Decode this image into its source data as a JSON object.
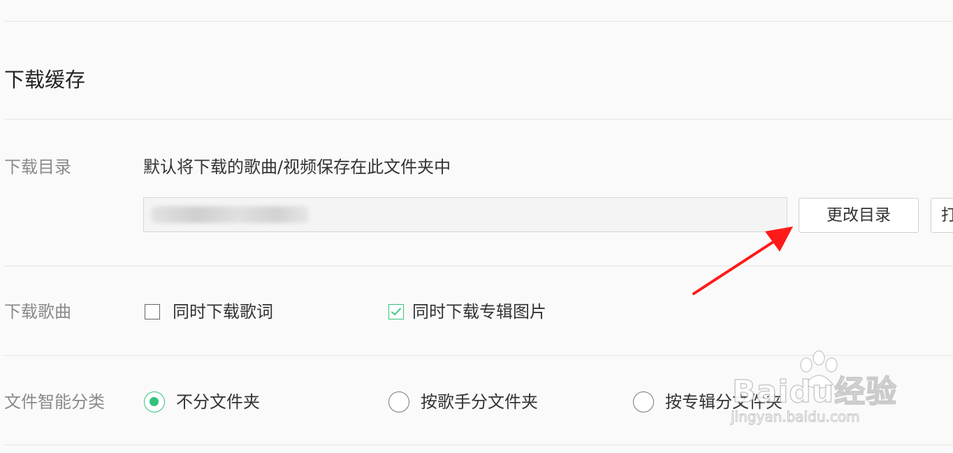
{
  "section": {
    "title": "下载缓存"
  },
  "download_dir": {
    "label": "下载目录",
    "description": "默认将下载的歌曲/视频保存在此文件夹中",
    "path_value": "",
    "change_button": "更改目录",
    "next_button_partial": "打"
  },
  "download_song": {
    "label": "下载歌曲",
    "options": [
      {
        "label": "同时下载歌词",
        "checked": false
      },
      {
        "label": "同时下载专辑图片",
        "checked": true
      }
    ]
  },
  "smart_classify": {
    "label": "文件智能分类",
    "options": [
      {
        "label": "不分文件夹",
        "selected": true
      },
      {
        "label": "按歌手分文件夹",
        "selected": false
      },
      {
        "label": "按专辑分文件夹",
        "selected": false
      }
    ]
  },
  "colors": {
    "accent": "#31c27c",
    "annotation_arrow": "#ff1a1a"
  },
  "icons": {
    "arrow": "red-arrow-icon",
    "check": "check-icon"
  },
  "watermark": {
    "brand": "Baidu经验",
    "url": "jingyan.baidu.com"
  }
}
